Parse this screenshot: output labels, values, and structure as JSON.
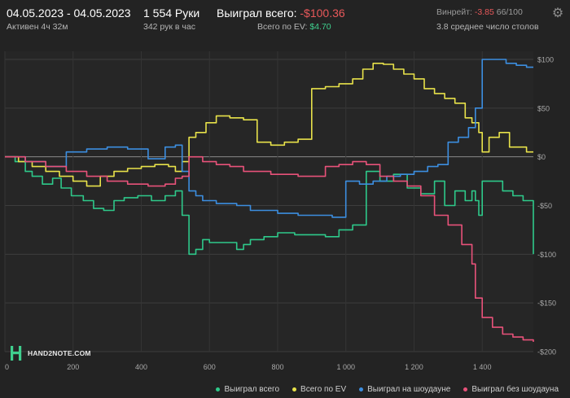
{
  "header": {
    "date_range": "04.05.2023 - 04.05.2023",
    "active": "Активен 4ч 32м",
    "hands": "1 554 Руки",
    "hands_per_hour": "342 рук в час",
    "won_total_label": "Выиграл всего:",
    "won_total_value": "-$100.36",
    "ev_label": "Всего по EV:",
    "ev_value": "$4.70",
    "winrate_label": "Винрейт:",
    "winrate_value": "-3.85",
    "winrate_hands": "66/100",
    "tables_avg": "3.8 среднее число столов"
  },
  "logo_text": "HAND2NOTE.COM",
  "chart_data": {
    "type": "line",
    "xlim": [
      0,
      1550
    ],
    "ylim": [
      -200,
      100
    ],
    "x_ticks": [
      0,
      200,
      400,
      600,
      800,
      1000,
      1200,
      1400
    ],
    "x_tick_labels": [
      "0",
      "200",
      "400",
      "600",
      "800",
      "1 000",
      "1 200",
      "1 400"
    ],
    "y_ticks": [
      100,
      50,
      0,
      -50,
      -100,
      -150,
      -200
    ],
    "y_tick_labels": [
      "$100",
      "$50",
      "$0",
      "-$50",
      "-$100",
      "-$150",
      "-$200"
    ],
    "grid": true,
    "legend_position": "bottom-right",
    "series": [
      {
        "name": "Выиграл всего",
        "color": "#2ec98a",
        "x": [
          0,
          30,
          60,
          80,
          110,
          140,
          165,
          195,
          230,
          260,
          290,
          320,
          350,
          390,
          430,
          470,
          500,
          520,
          540,
          560,
          580,
          600,
          640,
          680,
          700,
          720,
          760,
          800,
          850,
          900,
          940,
          980,
          1020,
          1060,
          1100,
          1140,
          1180,
          1220,
          1260,
          1290,
          1320,
          1350,
          1370,
          1380,
          1390,
          1400,
          1430,
          1460,
          1490,
          1520,
          1550
        ],
        "values": [
          0,
          -5,
          -15,
          -20,
          -28,
          -22,
          -32,
          -40,
          -45,
          -53,
          -55,
          -45,
          -42,
          -40,
          -45,
          -40,
          -35,
          -60,
          -100,
          -95,
          -85,
          -88,
          -88,
          -95,
          -90,
          -85,
          -82,
          -78,
          -80,
          -80,
          -82,
          -75,
          -70,
          -15,
          -25,
          -18,
          -32,
          -38,
          -25,
          -50,
          -35,
          -45,
          -35,
          -45,
          -60,
          -25,
          -25,
          -35,
          -40,
          -45,
          -100
        ]
      },
      {
        "name": "Всего по EV",
        "color": "#e8e24a",
        "x": [
          0,
          40,
          80,
          120,
          160,
          200,
          240,
          280,
          320,
          360,
          400,
          440,
          480,
          500,
          520,
          540,
          560,
          590,
          620,
          660,
          700,
          740,
          780,
          820,
          860,
          900,
          940,
          980,
          1020,
          1050,
          1080,
          1110,
          1140,
          1170,
          1200,
          1230,
          1260,
          1290,
          1320,
          1350,
          1370,
          1390,
          1400,
          1420,
          1450,
          1480,
          1510,
          1530,
          1550
        ],
        "values": [
          0,
          -5,
          -10,
          -15,
          -20,
          -25,
          -30,
          -20,
          -15,
          -12,
          -10,
          -8,
          -10,
          -15,
          -5,
          20,
          25,
          35,
          42,
          40,
          38,
          15,
          12,
          15,
          18,
          70,
          72,
          75,
          80,
          90,
          96,
          95,
          90,
          85,
          80,
          70,
          65,
          60,
          55,
          40,
          35,
          25,
          5,
          20,
          25,
          10,
          10,
          5,
          5
        ]
      },
      {
        "name": "Выиграл на шоудауне",
        "color": "#3c8ee0",
        "x": [
          0,
          60,
          120,
          180,
          240,
          300,
          360,
          420,
          470,
          500,
          520,
          540,
          560,
          580,
          620,
          680,
          720,
          760,
          800,
          860,
          920,
          960,
          980,
          1000,
          1040,
          1080,
          1120,
          1160,
          1200,
          1240,
          1270,
          1300,
          1330,
          1360,
          1380,
          1400,
          1420,
          1440,
          1470,
          1500,
          1530,
          1550
        ],
        "values": [
          0,
          -5,
          -10,
          5,
          8,
          10,
          8,
          -2,
          10,
          12,
          -15,
          -35,
          -40,
          -45,
          -48,
          -50,
          -55,
          -55,
          -58,
          -60,
          -60,
          -62,
          -62,
          -25,
          -28,
          -25,
          -20,
          -18,
          -15,
          -10,
          -8,
          15,
          20,
          30,
          50,
          100,
          100,
          100,
          96,
          94,
          92,
          92
        ]
      },
      {
        "name": "Выиграл без шоудауна",
        "color": "#e8527a",
        "x": [
          0,
          60,
          120,
          180,
          240,
          300,
          360,
          420,
          470,
          500,
          520,
          540,
          580,
          620,
          660,
          700,
          740,
          780,
          820,
          860,
          900,
          940,
          980,
          1020,
          1060,
          1100,
          1140,
          1180,
          1220,
          1260,
          1300,
          1340,
          1370,
          1380,
          1400,
          1430,
          1460,
          1490,
          1520,
          1550
        ],
        "values": [
          0,
          -5,
          -10,
          -15,
          -20,
          -25,
          -28,
          -30,
          -28,
          -22,
          -20,
          0,
          -5,
          -8,
          -10,
          -15,
          -15,
          -18,
          -18,
          -20,
          -20,
          -10,
          -8,
          -5,
          -8,
          -20,
          -25,
          -30,
          -40,
          -60,
          -70,
          -90,
          -110,
          -145,
          -165,
          -175,
          -182,
          -185,
          -188,
          -190
        ]
      }
    ]
  }
}
